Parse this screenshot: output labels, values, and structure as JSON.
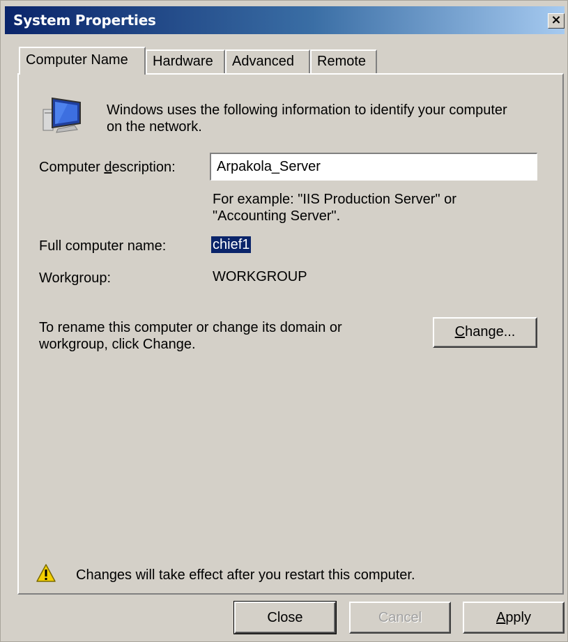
{
  "window": {
    "title": "System Properties",
    "close_glyph": "×"
  },
  "tabs": [
    {
      "label": "Computer Name",
      "active": true
    },
    {
      "label": "Hardware",
      "active": false
    },
    {
      "label": "Advanced",
      "active": false
    },
    {
      "label": "Remote",
      "active": false
    }
  ],
  "intro": {
    "line1": "Windows uses the following information to identify your computer",
    "line2": "on the network.",
    "icon": "computer-monitor-icon"
  },
  "description": {
    "label_pre": "Computer ",
    "label_accel": "d",
    "label_post": "escription:",
    "value": "Arpakola_Server",
    "example_line1": "For example: \"IIS Production Server\" or",
    "example_line2": "\"Accounting Server\"."
  },
  "full_name": {
    "label": "Full computer name:",
    "value": "chief1"
  },
  "workgroup": {
    "label": "Workgroup:",
    "value": "WORKGROUP"
  },
  "rename": {
    "line1": "To rename this computer or change its domain or",
    "line2": "workgroup, click Change.",
    "button_accel": "C",
    "button_rest": "hange..."
  },
  "warning": {
    "text": "Changes will take effect after you restart this computer.",
    "icon": "warning-icon",
    "color": "#f5d000"
  },
  "footer": {
    "close": "Close",
    "cancel": "Cancel",
    "apply_accel": "A",
    "apply_rest": "pply"
  },
  "colors": {
    "dialog_bg": "#d4d0c8",
    "title_start": "#0a246a",
    "title_end": "#a6caf0",
    "selection": "#0a246a"
  }
}
